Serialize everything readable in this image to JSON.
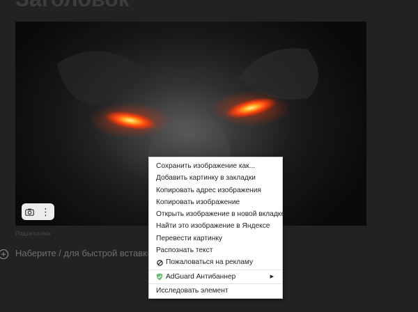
{
  "editor": {
    "title": "Заголовок",
    "caption": "Подзаголовок",
    "input_placeholder": "Наберите / для быстрой вставки",
    "image_toolbar": {
      "left_icon": "camera-icon",
      "right_icon": "more-vertical-icon",
      "more_glyph": "⋮"
    }
  },
  "context_menu": {
    "items": [
      {
        "label": "Сохранить изображение как..."
      },
      {
        "label": "Добавить картинку в закладки"
      },
      {
        "label": "Копировать адрес изображения"
      },
      {
        "label": "Копировать изображение"
      },
      {
        "label": "Открыть изображение в новой вкладке"
      },
      {
        "label": "Найти это изображение в Яндексе"
      },
      {
        "label": "Перевести картинку"
      },
      {
        "label": "Распознать текст"
      },
      {
        "label": "Пожаловаться на рекламу",
        "icon": "block-icon"
      }
    ],
    "adguard": {
      "label": "AdGuard Антибаннер",
      "icon": "adguard-shield-icon",
      "arrow": "▶",
      "accent": "#68bc71"
    },
    "inspect": {
      "label": "Исследовать элемент"
    }
  },
  "colors": {
    "page_background": "#222222",
    "eye_glow": "#ff5a1a",
    "menu_background": "#ffffff"
  }
}
